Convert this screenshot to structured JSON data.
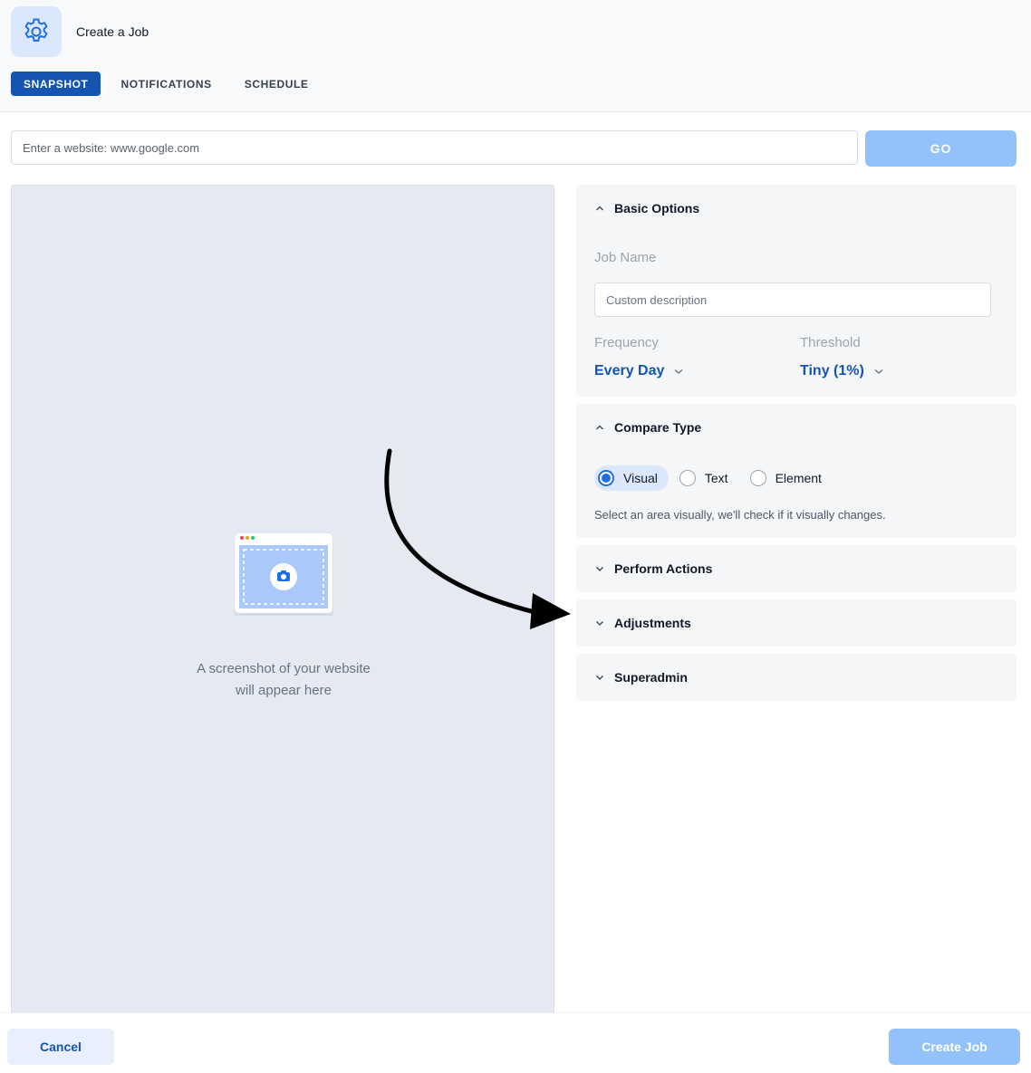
{
  "header": {
    "icon": "gear-icon",
    "title": "Create a Job",
    "tabs": [
      {
        "label": "SNAPSHOT",
        "active": true
      },
      {
        "label": "NOTIFICATIONS",
        "active": false
      },
      {
        "label": "SCHEDULE",
        "active": false
      }
    ]
  },
  "url_bar": {
    "placeholder": "Enter a website: www.google.com",
    "value": "",
    "go_label": "GO"
  },
  "preview": {
    "icon": "browser-camera-icon",
    "caption_line1": "A screenshot of your website",
    "caption_line2": "will appear here"
  },
  "basic_options": {
    "title": "Basic Options",
    "expanded": true,
    "job_name_label": "Job Name",
    "job_name_placeholder": "Custom description",
    "frequency_label": "Frequency",
    "frequency_value": "Every Day",
    "threshold_label": "Threshold",
    "threshold_value": "Tiny (1%)"
  },
  "compare_type": {
    "title": "Compare Type",
    "expanded": true,
    "options": [
      {
        "label": "Visual",
        "selected": true
      },
      {
        "label": "Text",
        "selected": false
      },
      {
        "label": "Element",
        "selected": false
      }
    ],
    "help_text": "Select an area visually, we'll check if it visually changes."
  },
  "sections": [
    {
      "title": "Perform Actions",
      "expanded": false
    },
    {
      "title": "Adjustments",
      "expanded": false
    },
    {
      "title": "Superadmin",
      "expanded": false
    }
  ],
  "footer": {
    "cancel_label": "Cancel",
    "create_label": "Create Job"
  },
  "colors": {
    "primary": "#1554b0",
    "primary_light": "#93c1fb",
    "radio_accent": "#1e6fe3",
    "panel_bg": "#f5f6f8",
    "preview_bg": "#e4e9f2"
  }
}
